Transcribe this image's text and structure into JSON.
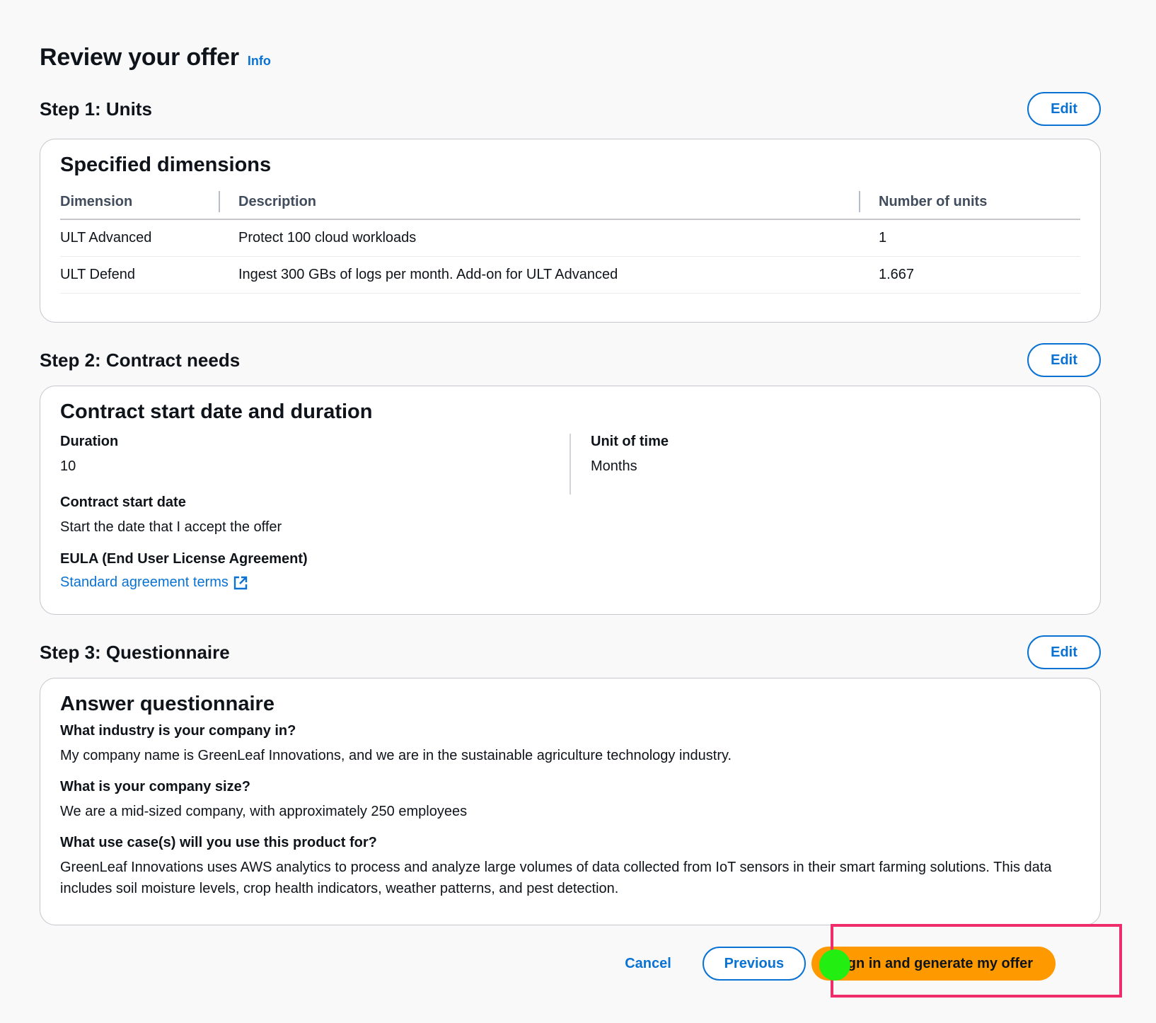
{
  "page": {
    "title": "Review your offer",
    "info_label": "Info"
  },
  "step1": {
    "title": "Step 1: Units",
    "edit_label": "Edit",
    "card_title": "Specified dimensions",
    "columns": [
      "Dimension",
      "Description",
      "Number of units"
    ],
    "rows": [
      [
        "ULT Advanced",
        "Protect 100 cloud workloads",
        "1"
      ],
      [
        "ULT Defend",
        "Ingest 300 GBs of logs per month. Add-on for ULT Advanced",
        "1.667"
      ]
    ]
  },
  "step2": {
    "title": "Step 2: Contract needs",
    "edit_label": "Edit",
    "card_title": "Contract start date and duration",
    "duration_label": "Duration",
    "duration_value": "10",
    "unit_label": "Unit of time",
    "unit_value": "Months",
    "start_label": "Contract start date",
    "start_value": "Start the date that I accept the offer",
    "eula_label": "EULA (End User License Agreement)",
    "eula_link": "Standard agreement terms"
  },
  "step3": {
    "title": "Step 3: Questionnaire",
    "edit_label": "Edit",
    "card_title": "Answer questionnaire",
    "qa": [
      {
        "q": "What industry is your company in?",
        "a": "My company name is GreenLeaf Innovations, and we are in the sustainable agriculture technology industry."
      },
      {
        "q": "What is your company size?",
        "a": "We are a mid-sized company, with approximately 250 employees"
      },
      {
        "q": "What use case(s) will you use this product for?",
        "a": "GreenLeaf Innovations uses AWS analytics to process and analyze large volumes of data collected from IoT sensors in their smart farming solutions. This data includes soil moisture levels, crop health indicators, weather patterns, and pest detection."
      }
    ]
  },
  "footer": {
    "cancel_label": "Cancel",
    "previous_label": "Previous",
    "submit_label": "Sign in and generate my offer"
  },
  "colors": {
    "accent": "#0972d3",
    "primary_button": "#ff9900",
    "highlight": "#ef2d6b",
    "cursor": "#22ee11"
  },
  "icons": {
    "external_link": "external-link-icon"
  }
}
